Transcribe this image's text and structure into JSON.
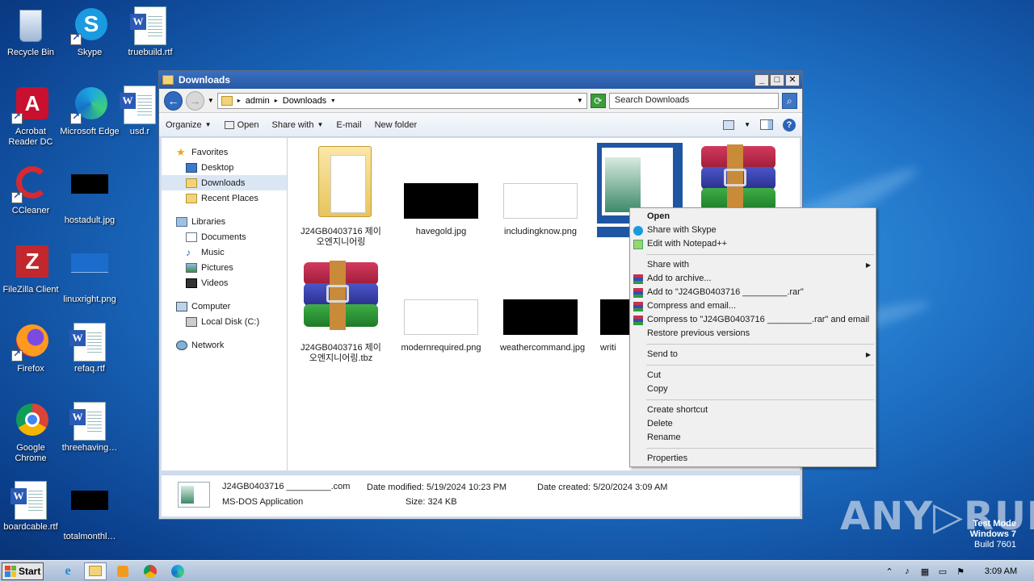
{
  "desktop": {
    "icons": [
      {
        "label": "Recycle Bin"
      },
      {
        "label": "Skype"
      },
      {
        "label": "truebuild.rtf"
      },
      {
        "label": "Acrobat Reader DC"
      },
      {
        "label": "Microsoft Edge"
      },
      {
        "label": "usd.r"
      },
      {
        "label": "CCleaner"
      },
      {
        "label": "hostadult.jpg"
      },
      {
        "label": "FileZilla Client"
      },
      {
        "label": "linuxright.png"
      },
      {
        "label": "Firefox"
      },
      {
        "label": "refaq.rtf"
      },
      {
        "label": "Google Chrome"
      },
      {
        "label": "threehaving…"
      },
      {
        "label": "boardcable.rtf"
      },
      {
        "label": "totalmonthl…"
      }
    ]
  },
  "explorer": {
    "title": "Downloads",
    "address": {
      "crumb1": "admin",
      "crumb2": "Downloads"
    },
    "search_placeholder": "Search Downloads",
    "toolbar": {
      "organize": "Organize",
      "open": "Open",
      "share_with": "Share with",
      "email": "E-mail",
      "new_folder": "New folder"
    },
    "nav": {
      "favorites": "Favorites",
      "desktop": "Desktop",
      "downloads": "Downloads",
      "recent": "Recent Places",
      "libraries": "Libraries",
      "documents": "Documents",
      "music": "Music",
      "pictures": "Pictures",
      "videos": "Videos",
      "computer": "Computer",
      "local_disk": "Local Disk (C:)",
      "network": "Network"
    },
    "files": [
      {
        "name": "J24GB0403716 제이오엔지니어링"
      },
      {
        "name": "havegold.jpg"
      },
      {
        "name": "includingknow.png"
      },
      {
        "name": "J24G"
      },
      {
        "name": ""
      },
      {
        "name": "J24GB0403716 제이오엔지니어링.tbz"
      },
      {
        "name": "modernrequired.png"
      },
      {
        "name": "weathercommand.jpg"
      },
      {
        "name": "writi"
      }
    ],
    "details": {
      "name": "J24GB0403716 _________.com",
      "date_modified": "Date modified: 5/19/2024 10:23 PM",
      "date_created": "Date created: 5/20/2024 3:09 AM",
      "type": "MS-DOS Application",
      "size": "Size: 324 KB"
    }
  },
  "context_menu": {
    "open": "Open",
    "share_skype": "Share with Skype",
    "edit_npp": "Edit with Notepad++",
    "share_with": "Share with",
    "add_archive": "Add to archive...",
    "add_to_rar": "Add to \"J24GB0403716 _________.rar\"",
    "compress_email": "Compress and email...",
    "compress_to_rar_email": "Compress to \"J24GB0403716 _________.rar\" and email",
    "restore": "Restore previous versions",
    "send_to": "Send to",
    "cut": "Cut",
    "copy": "Copy",
    "create_shortcut": "Create shortcut",
    "delete": "Delete",
    "rename": "Rename",
    "properties": "Properties"
  },
  "taskbar": {
    "start": "Start",
    "clock": "3:09 AM"
  },
  "watermark": {
    "line1": "Test Mode",
    "line2": "Windows 7",
    "line3": "Build 7601",
    "brand": "ANY▷RUN"
  }
}
